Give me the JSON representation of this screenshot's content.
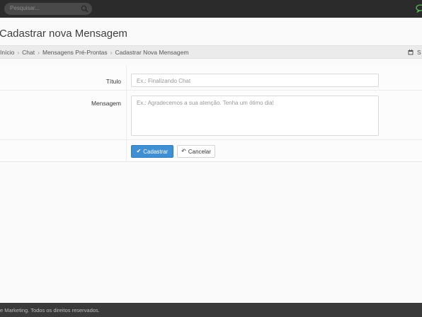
{
  "topbar": {
    "search_placeholder": "Pesquisar...",
    "search_icon": "search-icon",
    "chat_icon": "chat-icon",
    "accent_color": "#5cb85c"
  },
  "page": {
    "title": "Cadastrar nova Mensagem"
  },
  "breadcrumb": {
    "items": [
      "Início",
      "Chat",
      "Mensagens Pré-Prontas",
      "Cadastrar Nova Mensagem"
    ],
    "date_label": "S"
  },
  "form": {
    "title_label": "Título",
    "title_placeholder": "Ex.: Finalizando Chat",
    "message_label": "Mensagem",
    "message_placeholder": "Ex.: Agradecemos a sua atenção. Tenha um ótimo dia!",
    "submit_label": "Cadastrar",
    "cancel_label": "Cancelar",
    "primary_color": "#3f8fd2"
  },
  "footer": {
    "text": "e Marketing. Todos os direitos reservados."
  }
}
